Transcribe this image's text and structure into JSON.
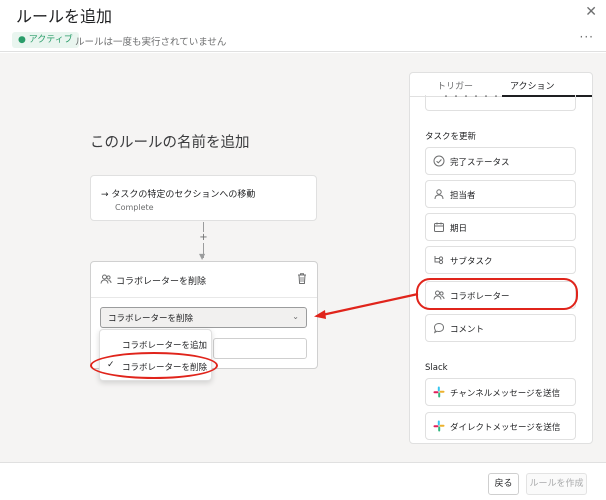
{
  "header": {
    "title": "ルールを追加",
    "close_icon": "close-icon"
  },
  "status": {
    "badge": "● アクティブ",
    "text": "ルールは一度も実行されていません",
    "more": "···"
  },
  "rule": {
    "name_placeholder": "このルールの名前を追加"
  },
  "trigger": {
    "title": "→ タスクの特定のセクションへの移動",
    "subtitle": "Complete"
  },
  "connector": {
    "plus": "+",
    "arrow": "▼"
  },
  "action": {
    "title": "コラボレーターを削除",
    "select_value": "コラボレーターを削除",
    "chevron": "⌄",
    "dropdown": [
      {
        "label": "コラボレーターを追加",
        "checked": false
      },
      {
        "label": "コラボレーターを削除",
        "checked": true
      }
    ],
    "checkmark": "✓"
  },
  "panel": {
    "tabs": [
      {
        "label": "トリガー",
        "active": false
      },
      {
        "label": "アクション",
        "active": true
      }
    ],
    "partial_item": "・・・・・・",
    "task_section": "タスクを更新",
    "task_items": [
      {
        "label": "完了ステータス",
        "icon": "check-circle-icon"
      },
      {
        "label": "担当者",
        "icon": "person-icon"
      },
      {
        "label": "期日",
        "icon": "calendar-icon"
      },
      {
        "label": "サブタスク",
        "icon": "subtask-icon"
      },
      {
        "label": "コラボレーター",
        "icon": "collaborators-icon"
      },
      {
        "label": "コメント",
        "icon": "comment-icon"
      }
    ],
    "slack_section": "Slack",
    "slack_items": [
      {
        "label": "チャンネルメッセージを送信",
        "icon": "slack-icon"
      },
      {
        "label": "ダイレクトメッセージを送信",
        "icon": "slack-icon"
      }
    ]
  },
  "footer": {
    "back_label": "戻る",
    "create_label": "ルールを作成"
  },
  "colors": {
    "annotation_red": "#e0241b",
    "active_green": "#2a9d6a",
    "canvas_bg": "#f5f4f3"
  }
}
